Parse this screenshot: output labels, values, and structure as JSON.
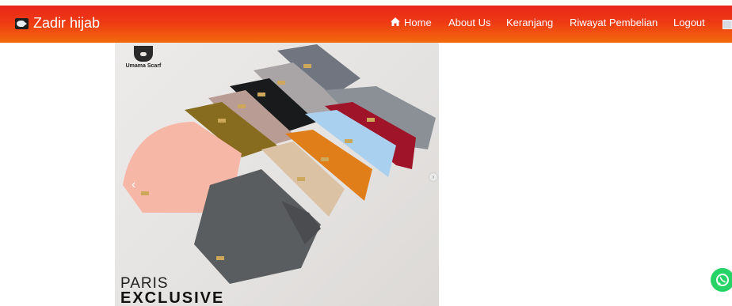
{
  "navbar": {
    "brand": "Zadir hijab",
    "items": [
      {
        "label": "Home",
        "icon": "home-icon"
      },
      {
        "label": "About Us"
      },
      {
        "label": "Keranjang"
      },
      {
        "label": "Riwayat Pembelian"
      },
      {
        "label": "Logout"
      }
    ],
    "colors": {
      "start": "#e8261a",
      "end": "#f26a0c"
    }
  },
  "product_image": {
    "brand_name": "Umama Scarf",
    "title_line1": "PARIS",
    "title_line2": "EXCLUSIVE",
    "prev_arrow": "‹",
    "next_arrow": "›"
  },
  "floating": {
    "icon": "whatsapp-icon",
    "color": "#25d366"
  }
}
